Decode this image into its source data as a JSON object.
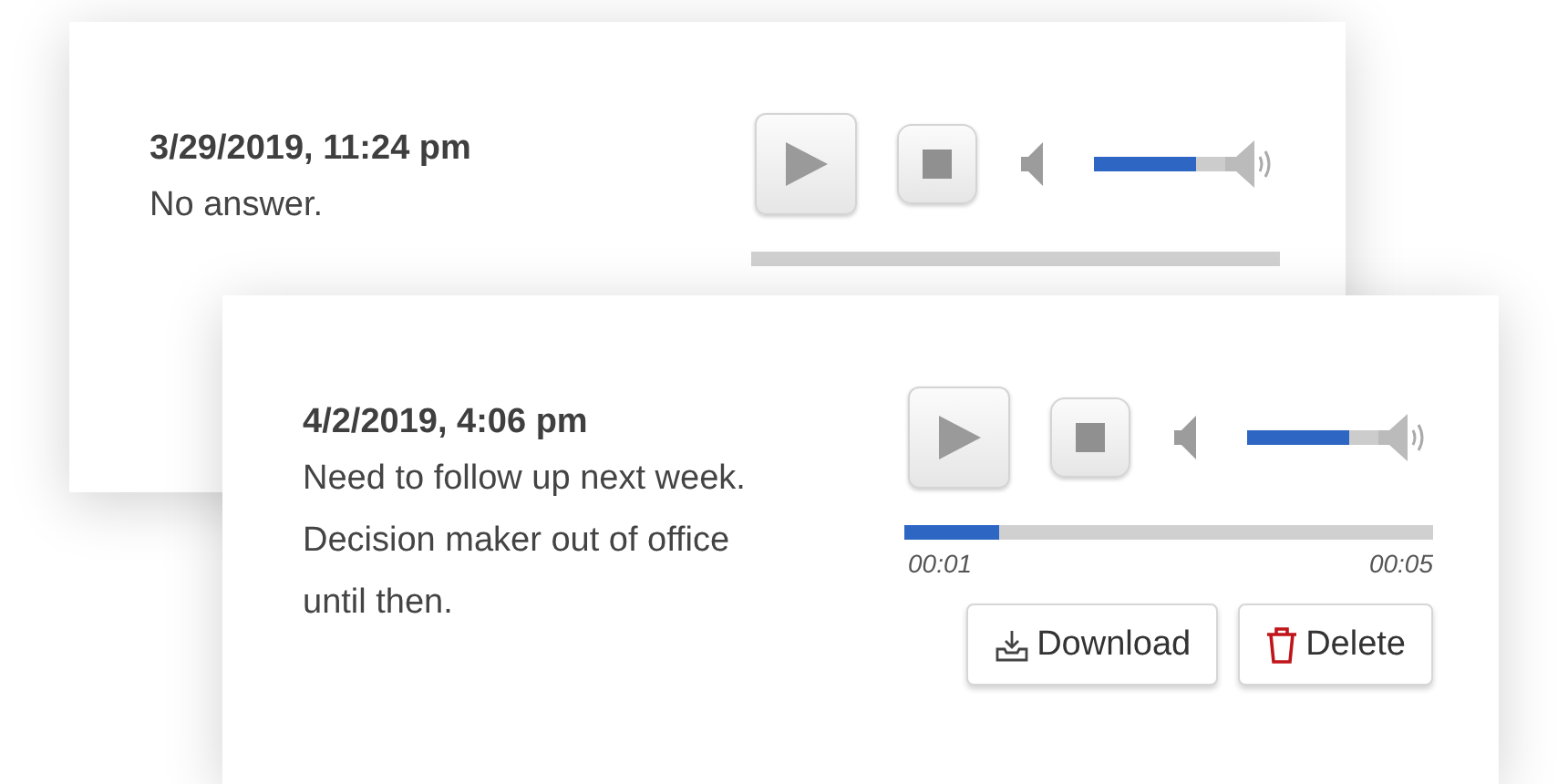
{
  "recordings": [
    {
      "date": "3/29/2019, 11:24 pm",
      "note": "No answer.",
      "volume": {
        "level": 0.78
      },
      "progress": {
        "level": 0
      }
    },
    {
      "date": "4/2/2019, 4:06 pm",
      "note": "Need to follow up next week. Decision maker out of office until then.",
      "volume": {
        "level": 0.78
      },
      "progress": {
        "level": 0.18
      },
      "elapsed": "00:01",
      "duration": "00:05",
      "actions": [
        {
          "kind": "download",
          "label": "Download"
        },
        {
          "kind": "delete",
          "label": "Delete"
        }
      ]
    }
  ]
}
